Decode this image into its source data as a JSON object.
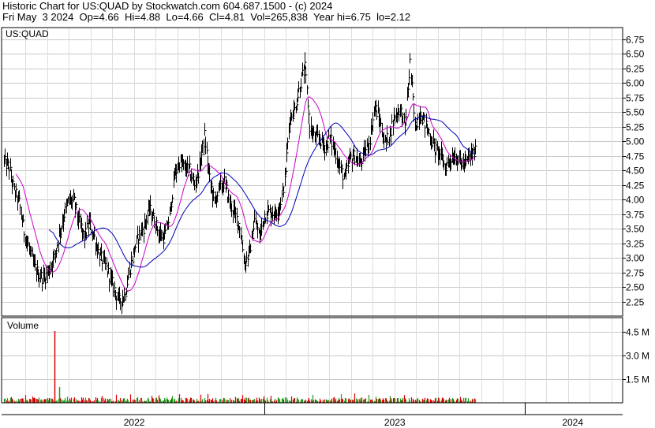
{
  "header": {
    "line1": "Historic Chart for US:QUAD by Stockwatch.com 604.687.1500 - (c) 2024",
    "line2": "Fri May  3 2024  Op=4.66  Hi=4.88  Lo=4.66  Cl=4.81  Vol=265,838  Year hi=6.75  lo=2.12"
  },
  "chart_data": {
    "type": "line",
    "symbol_label": "US:QUAD",
    "volume_label": "Volume",
    "price_ticks": [
      "6.75",
      "6.50",
      "6.25",
      "6.00",
      "5.75",
      "5.50",
      "5.25",
      "5.00",
      "4.75",
      "4.50",
      "4.25",
      "4.00",
      "3.75",
      "3.50",
      "3.25",
      "3.00",
      "2.75",
      "2.50",
      "2.25"
    ],
    "price_ylim": [
      2.0,
      6.95
    ],
    "volume_ticks": [
      "4.5 M",
      "3.0 M",
      "1.5 M"
    ],
    "volume_ylim": [
      0,
      5.4
    ],
    "x_labels": [
      "2022",
      "2023",
      "2024"
    ],
    "x_label_weeks": [
      0,
      52,
      104
    ],
    "weeks_total": 123,
    "price_weekly": [
      4.65,
      4.55,
      4.15,
      3.95,
      3.45,
      3.15,
      2.85,
      2.7,
      2.65,
      2.8,
      3.0,
      3.4,
      3.75,
      4.0,
      3.95,
      3.6,
      3.35,
      3.6,
      3.35,
      3.05,
      2.9,
      2.7,
      2.45,
      2.25,
      2.35,
      2.75,
      3.15,
      3.4,
      3.55,
      3.85,
      3.65,
      3.4,
      3.35,
      3.7,
      4.4,
      4.65,
      4.55,
      4.5,
      4.25,
      4.55,
      5.1,
      4.35,
      3.95,
      4.2,
      4.3,
      3.95,
      3.75,
      3.55,
      2.9,
      3.1,
      3.65,
      3.35,
      3.75,
      3.8,
      3.75,
      3.9,
      4.3,
      5.4,
      5.55,
      5.95,
      6.25,
      5.25,
      5.05,
      5.05,
      4.9,
      5.05,
      4.85,
      4.55,
      4.35,
      4.7,
      4.75,
      4.6,
      4.8,
      5.05,
      5.6,
      5.35,
      4.95,
      5.15,
      5.45,
      5.55,
      5.25,
      6.35,
      5.25,
      5.5,
      5.3,
      5.1,
      4.85,
      4.8,
      4.55,
      4.7,
      4.75,
      4.65,
      4.6,
      4.75,
      4.81
    ],
    "ma_short_color": "#cc00cc",
    "ma_long_color": "#0000bb",
    "up_volume_color": "#229922",
    "down_volume_color": "#dd0000",
    "grid": true
  }
}
